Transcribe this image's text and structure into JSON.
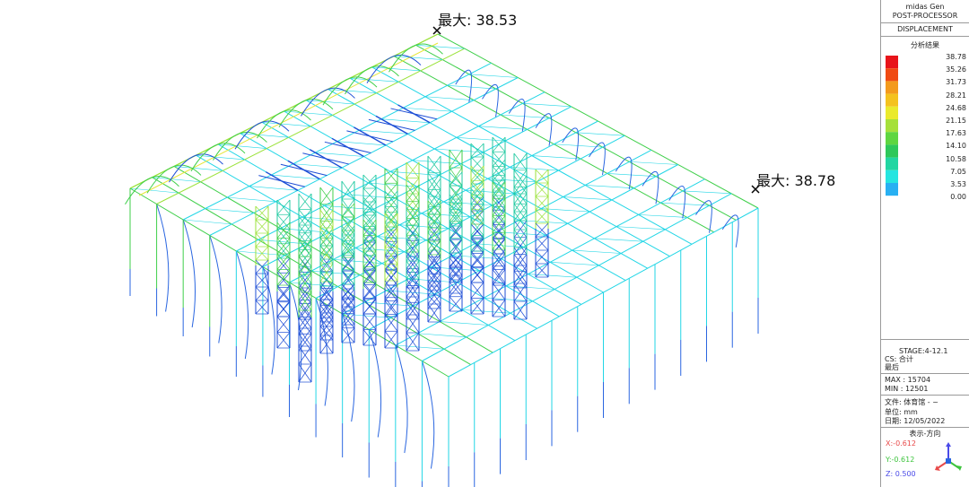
{
  "markers": [
    {
      "label": "最大: 38.53"
    },
    {
      "label": "最大: 38.78"
    }
  ],
  "panel": {
    "app": "midas Gen",
    "module": "POST-PROCESSOR",
    "result_type": "DISPLACEMENT",
    "legend_title": "分析结果",
    "legend": [
      {
        "value": "38.78",
        "color": "#e8141a"
      },
      {
        "value": "35.26",
        "color": "#f04a12"
      },
      {
        "value": "31.73",
        "color": "#f39a1c"
      },
      {
        "value": "28.21",
        "color": "#f4c21e"
      },
      {
        "value": "24.68",
        "color": "#eaea2c"
      },
      {
        "value": "21.15",
        "color": "#a6e03a"
      },
      {
        "value": "17.63",
        "color": "#5ed640"
      },
      {
        "value": "14.10",
        "color": "#2ec85a"
      },
      {
        "value": "10.58",
        "color": "#22d6a2"
      },
      {
        "value": "7.05",
        "color": "#25e5e0"
      },
      {
        "value": "3.53",
        "color": "#28b0f2"
      },
      {
        "value": "0.00",
        "color": "#2a66e0"
      }
    ],
    "stage": "STAGE:4-12.1",
    "cs": "CS: 合计",
    "step": "最后",
    "max": "MAX : 15704",
    "min": "MIN : 12501",
    "file": "文件: 体育馆 - ~",
    "unit": "单位: mm",
    "date": "日期: 12/05/2022",
    "view_dir": "表示-方向",
    "x": "X:-0.612",
    "y": "Y:-0.612",
    "z": "Z: 0.500",
    "x_color": "#e84a4a",
    "y_color": "#3ec43e",
    "z_color": "#4a4ae8"
  }
}
